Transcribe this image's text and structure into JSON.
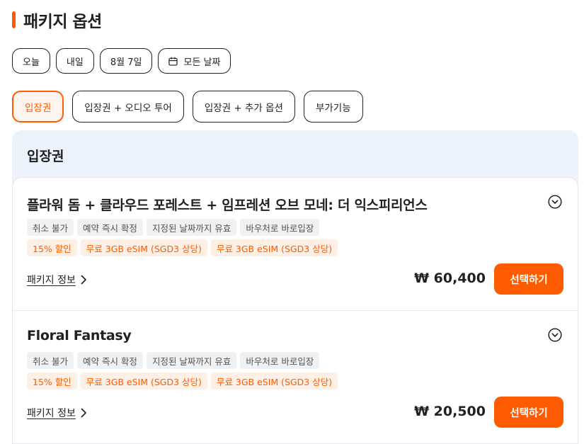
{
  "header": {
    "title": "패키지 옵션",
    "accent_color": "#ff5b00"
  },
  "dates": [
    {
      "label": "오늘"
    },
    {
      "label": "내일"
    },
    {
      "label": "8월 7일"
    },
    {
      "label": "모든 날짜",
      "icon": "calendar-icon"
    }
  ],
  "options": [
    {
      "label": "입장권",
      "selected": true
    },
    {
      "label": "입장권 + 오디오 투어",
      "selected": false
    },
    {
      "label": "입장권 + 추가 옵션",
      "selected": false
    },
    {
      "label": "부가기능",
      "selected": false
    }
  ],
  "panel": {
    "title": "입장권"
  },
  "packages": [
    {
      "name": "플라워 돔 + 클라우드 포레스트 + 임프레션 오브 모네: 더 익스피리언스",
      "gray_tags": [
        "취소 불가",
        "예약 즉시 확정",
        "지정된 날짜까지 유효",
        "바우처로 바로입장"
      ],
      "orange_tags": [
        "15% 할인",
        "무료 3GB eSIM (SGD3 상당)",
        "무료 3GB eSIM (SGD3 상당)"
      ],
      "info_label": "패키지 정보",
      "price": "₩ 60,400",
      "button_label": "선택하기"
    },
    {
      "name": "Floral Fantasy",
      "gray_tags": [
        "취소 불가",
        "예약 즉시 확정",
        "지정된 날짜까지 유효",
        "바우처로 바로입장"
      ],
      "orange_tags": [
        "15% 할인",
        "무료 3GB eSIM (SGD3 상당)",
        "무료 3GB eSIM (SGD3 상당)"
      ],
      "info_label": "패키지 정보",
      "price": "₩ 20,500",
      "button_label": "선택하기"
    }
  ]
}
